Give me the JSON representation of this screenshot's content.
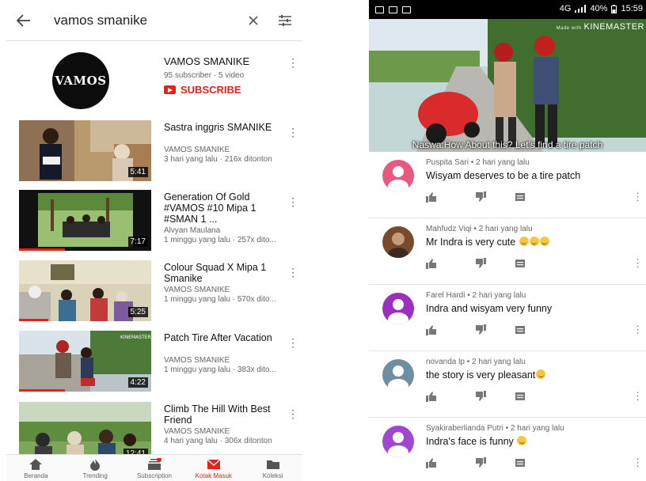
{
  "left": {
    "search": {
      "query": "vamos smanike"
    },
    "channel": {
      "avatar_text": "VAMOS",
      "name": "VAMOS SMANIKE",
      "meta": "95 subscriber · 5 video",
      "subscribe_label": "SUBSCRIBE"
    },
    "videos": [
      {
        "title": "Sastra inggris SMANIKE",
        "channel": "VAMOS SMANIKE",
        "meta": "3 hari yang lalu · 216x ditonton",
        "duration": "5:41",
        "progress": 0
      },
      {
        "title": "Generation Of Gold #VAMOS #10 Mipa 1 #SMAN 1 ...",
        "channel": "Alvyan Maulana",
        "meta": "1 minggu yang lalu · 257x dito...",
        "duration": "7:17",
        "progress": 0.35
      },
      {
        "title": "Colour Squad X Mipa 1 Smanike",
        "channel": "VAMOS SMANIKE",
        "meta": "1 minggu yang lalu · 570x dito...",
        "duration": "5:25",
        "progress": 0.22
      },
      {
        "title": "Patch Tire After Vacation",
        "channel": "VAMOS SMANIKE",
        "meta": "1 minggu yang lalu · 383x dito...",
        "duration": "4:22",
        "progress": 0.35
      },
      {
        "title": "Climb The Hill With Best Friend",
        "channel": "VAMOS SMANIKE",
        "meta": "4 hari yang lalu · 306x ditonton",
        "duration": "12:41",
        "progress": 0
      }
    ],
    "bottom_nav": [
      {
        "label": "Beranda",
        "icon": "home-icon"
      },
      {
        "label": "Trending",
        "icon": "trending-icon"
      },
      {
        "label": "Subscription",
        "icon": "subscriptions-icon"
      },
      {
        "label": "Kotak Masuk",
        "icon": "inbox-icon",
        "active": true
      },
      {
        "label": "Koleksi",
        "icon": "library-icon"
      }
    ]
  },
  "right": {
    "status": {
      "network": "4G",
      "battery": "40%",
      "time": "15:59"
    },
    "video": {
      "watermark": "KINEMASTER",
      "watermark_prefix": "Made with",
      "subtitle": "Naswa:How About this? Let's find a tire patch"
    },
    "comments": [
      {
        "author": "Puspita Sari",
        "time": "2 hari yang lalu",
        "text": "Wisyam deserves to be a tire patch",
        "emoji_count": 0,
        "avatar_color": "#e85a7d"
      },
      {
        "author": "Mahfudz Viqi",
        "time": "2 hari yang lalu",
        "text": "Mr Indra is very cute",
        "emoji_count": 3,
        "avatar_color": "#7a4a2e"
      },
      {
        "author": "Farel Hardi",
        "time": "2 hari yang lalu",
        "text": "Indra and wisyam very funny",
        "emoji_count": 0,
        "avatar_color": "#9b2fbf"
      },
      {
        "author": "novanda lp",
        "time": "2 hari yang lalu",
        "text": "the story is very pleasant",
        "emoji_count": 1,
        "avatar_color": "#6e8fa3"
      },
      {
        "author": "Syakiraberlianda Putri",
        "time": "2 hari yang lalu",
        "text": "Indra's face is funny",
        "emoji_count": 1,
        "avatar_color": "#a046d1"
      }
    ]
  }
}
